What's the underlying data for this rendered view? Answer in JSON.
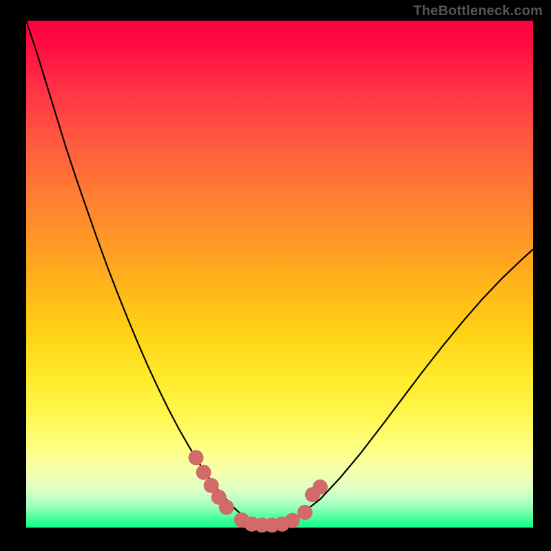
{
  "watermark": "TheBottleneck.com",
  "colors": {
    "background": "#000000",
    "curve_stroke": "#000000",
    "marker_fill": "#d36a6a",
    "watermark_text": "#555555"
  },
  "chart_data": {
    "type": "line",
    "title": "",
    "xlabel": "",
    "ylabel": "",
    "xlim": [
      0,
      100
    ],
    "ylim": [
      0,
      100
    ],
    "x": [
      0,
      2,
      4,
      6,
      8,
      10,
      12,
      14,
      16,
      18,
      20,
      22,
      24,
      26,
      28,
      30,
      32,
      34,
      36,
      37.5,
      39,
      41,
      43,
      45.5,
      48,
      51,
      54,
      58,
      62,
      66,
      70,
      74,
      78,
      82,
      86,
      90,
      94,
      98,
      100
    ],
    "values": [
      100,
      94,
      87.5,
      81,
      74.5,
      68.5,
      62.7,
      57,
      51.5,
      46.3,
      41.3,
      36.5,
      31.9,
      27.6,
      23.5,
      19.7,
      16.2,
      12.9,
      9.9,
      7.9,
      6.1,
      3.9,
      2.1,
      0.8,
      0.2,
      0.8,
      2.5,
      5.6,
      9.9,
      14.7,
      19.9,
      25.2,
      30.5,
      35.6,
      40.5,
      45.1,
      49.3,
      53.1,
      54.9
    ],
    "markers": [
      {
        "x": 33.5,
        "y": 13.8
      },
      {
        "x": 35.0,
        "y": 10.9
      },
      {
        "x": 36.5,
        "y": 8.3
      },
      {
        "x": 38.0,
        "y": 6.0
      },
      {
        "x": 39.5,
        "y": 4.0
      },
      {
        "x": 42.5,
        "y": 1.5
      },
      {
        "x": 44.5,
        "y": 0.7
      },
      {
        "x": 46.5,
        "y": 0.5
      },
      {
        "x": 48.5,
        "y": 0.5
      },
      {
        "x": 50.5,
        "y": 0.7
      },
      {
        "x": 52.5,
        "y": 1.4
      },
      {
        "x": 55.0,
        "y": 3.0
      },
      {
        "x": 56.5,
        "y": 6.5
      },
      {
        "x": 58.0,
        "y": 8.0
      }
    ],
    "gradient_stops": [
      {
        "pct": 0,
        "color": "#ff0040"
      },
      {
        "pct": 14,
        "color": "#ff3446"
      },
      {
        "pct": 34,
        "color": "#ff7c32"
      },
      {
        "pct": 53,
        "color": "#ffb719"
      },
      {
        "pct": 70,
        "color": "#ffe92a"
      },
      {
        "pct": 84,
        "color": "#feff80"
      },
      {
        "pct": 93,
        "color": "#d8ffc7"
      },
      {
        "pct": 100,
        "color": "#0fff86"
      }
    ]
  }
}
